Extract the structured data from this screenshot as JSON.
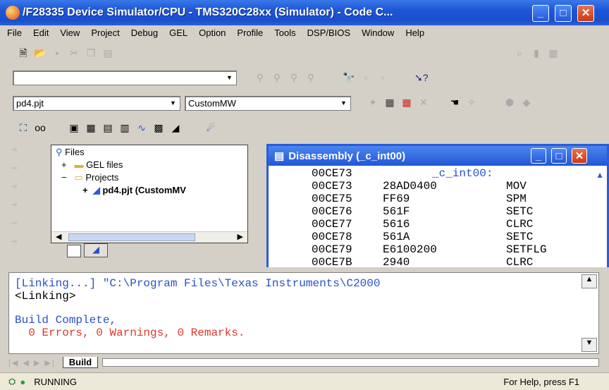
{
  "window": {
    "title": "/F28335 Device Simulator/CPU - TMS320C28xx (Simulator) - Code C..."
  },
  "menu": [
    "File",
    "Edit",
    "View",
    "Project",
    "Debug",
    "GEL",
    "Option",
    "Profile",
    "Tools",
    "DSP/BIOS",
    "Window",
    "Help"
  ],
  "toolbar": {
    "project_combo": "pd4.pjt",
    "config_combo": "CustomMW",
    "search_combo": ""
  },
  "file_tree": {
    "root": "Files",
    "gel": "GEL files",
    "projects": "Projects",
    "project": "pd4.pjt (CustomMV"
  },
  "disassembly": {
    "title": "Disassembly (_c_int00)",
    "label_addr": "00CE73",
    "label": "_c_int00:",
    "rows": [
      {
        "addr": "00CE73",
        "op": "28AD0400",
        "mnem": "MOV"
      },
      {
        "addr": "00CE75",
        "op": "FF69",
        "mnem": "SPM"
      },
      {
        "addr": "00CE76",
        "op": "561F",
        "mnem": "SETC"
      },
      {
        "addr": "00CE77",
        "op": "5616",
        "mnem": "CLRC"
      },
      {
        "addr": "00CE78",
        "op": "561A",
        "mnem": "SETC"
      },
      {
        "addr": "00CE79",
        "op": "E6100200",
        "mnem": "SETFLG"
      },
      {
        "addr": "00CE7B",
        "op": "2940",
        "mnem": "CLRC"
      }
    ]
  },
  "output": {
    "line1": "[Linking...] \"C:\\Program Files\\Texas Instruments\\C2000 ",
    "line2": "<Linking>",
    "line3": "Build Complete,",
    "line4": "  0 Errors, 0 Warnings, 0 Remarks."
  },
  "output_tab": "Build",
  "status": {
    "state": "RUNNING",
    "help": "For Help, press F1"
  },
  "colors": {
    "blue_text": "#2a4fd0",
    "red_text": "#e0382a",
    "title_blue": "#1d56d6"
  }
}
